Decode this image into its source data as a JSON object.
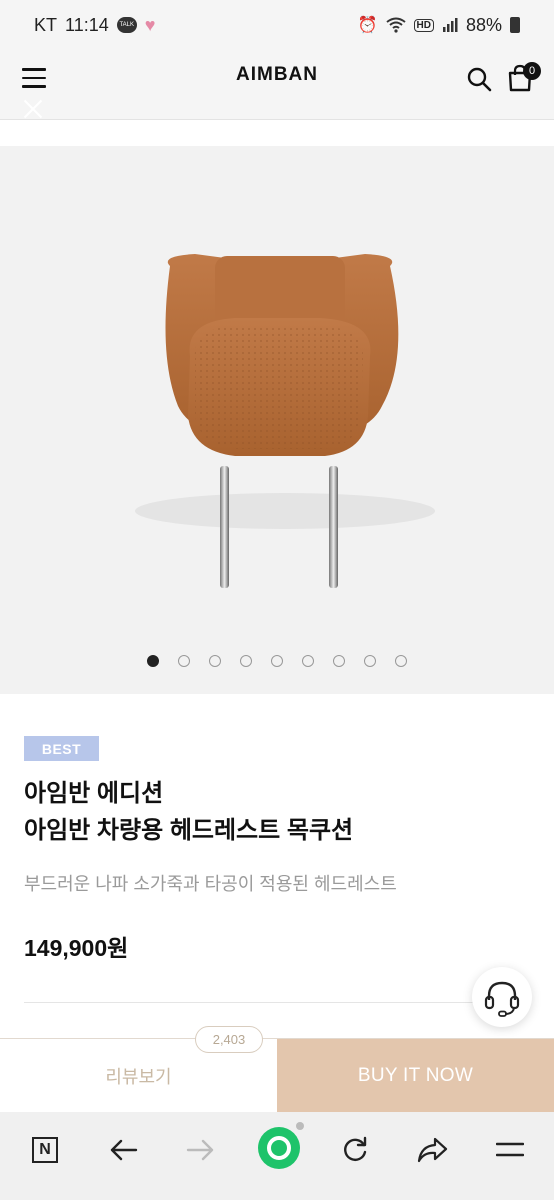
{
  "status_bar": {
    "carrier": "KT",
    "time": "11:14",
    "talk_label": "TALK",
    "hd_label": "HD",
    "battery": "88%"
  },
  "header": {
    "logo": "AIMBAN",
    "cart_count": "0"
  },
  "carousel": {
    "image_alt": "headrest-product-photo",
    "total_slides": 9,
    "active_index": 0
  },
  "product": {
    "badge": "BEST",
    "title_line1": "아임반 에디션",
    "title_line2": "아임반 차량용 헤드레스트 목쿠션",
    "description": "부드러운 나파 소가죽과 타공이 적용된 헤드레스트",
    "price": "149,900원"
  },
  "actions": {
    "review_count": "2,403",
    "review_label": "리뷰보기",
    "buy_label": "BUY IT NOW"
  },
  "colors": {
    "accent_buy": "#e3c6ad",
    "badge_bg": "#b7c6ea",
    "browser_green": "#1ec36a",
    "leather": "#b46e3f"
  }
}
